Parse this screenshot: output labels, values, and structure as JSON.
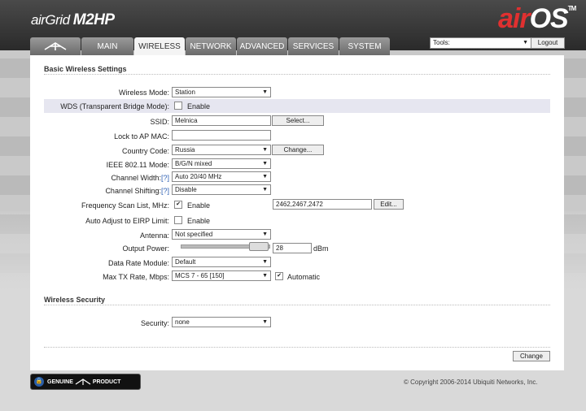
{
  "header": {
    "device_logo": "airGrid M2HP",
    "device_logo_prefix": "air",
    "device_logo_suffix": "Grid",
    "device_logo_model": "M2HP",
    "os_logo_air": "air",
    "os_logo_os": "OS",
    "os_logo_tm": "TM"
  },
  "tabs": [
    {
      "label": "MAIN"
    },
    {
      "label": "WIRELESS"
    },
    {
      "label": "NETWORK"
    },
    {
      "label": "ADVANCED"
    },
    {
      "label": "SERVICES"
    },
    {
      "label": "SYSTEM"
    }
  ],
  "tools": {
    "label": "Tools:",
    "logout": "Logout"
  },
  "basic": {
    "title": "Basic Wireless Settings",
    "wireless_mode_label": "Wireless Mode:",
    "wireless_mode_value": "Station",
    "wds_label": "WDS (Transparent Bridge Mode):",
    "wds_enable": "Enable",
    "ssid_label": "SSID:",
    "ssid_value": "Melnica",
    "ssid_select": "Select...",
    "lock_label": "Lock to AP MAC:",
    "lock_value": "",
    "country_label": "Country Code:",
    "country_value": "Russia",
    "country_change": "Change...",
    "ieee_label": "IEEE 802.11 Mode:",
    "ieee_value": "B/G/N mixed",
    "width_label": "Channel Width:",
    "width_help": "[?]",
    "width_value": "Auto 20/40 MHz",
    "shift_label": "Channel Shifting:",
    "shift_help": "[?]",
    "shift_value": "Disable",
    "freq_label": "Frequency Scan List, MHz:",
    "freq_enable": "Enable",
    "freq_value": "2462,2467,2472",
    "freq_edit": "Edit...",
    "eirp_label": "Auto Adjust to EIRP Limit:",
    "eirp_enable": "Enable",
    "antenna_label": "Antenna:",
    "antenna_value": "Not specified",
    "power_label": "Output Power:",
    "power_value": "28",
    "power_unit": "dBm",
    "rate_module_label": "Data Rate Module:",
    "rate_module_value": "Default",
    "max_tx_label": "Max TX Rate, Mbps:",
    "max_tx_value": "MCS 7 - 65 [150]",
    "max_tx_auto": "Automatic"
  },
  "security": {
    "title": "Wireless Security",
    "label": "Security:",
    "value": "none"
  },
  "footer": {
    "change": "Change",
    "badge_left": "GENUINE",
    "badge_right": "PRODUCT",
    "copyright": "© Copyright 2006-2014 Ubiquiti Networks, Inc."
  }
}
